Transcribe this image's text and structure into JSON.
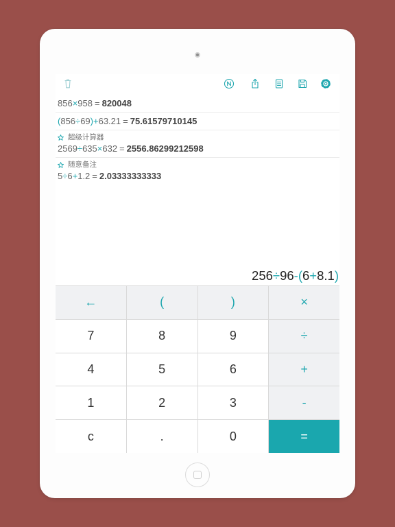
{
  "colors": {
    "backdrop": "#9a4f4a",
    "accent": "#1fa7af",
    "operator_key_background": "#f0f1f3",
    "equals_key_background": "#1aa7ae"
  },
  "toolbar": {
    "icons": [
      "trash-icon",
      "letter-n-circle-icon",
      "share-icon",
      "document-list-icon",
      "save-icon",
      "settings-gear-icon"
    ]
  },
  "history": [
    {
      "expression": "856×958",
      "equals": "=",
      "result": "820048"
    },
    {
      "expression": "(856÷69)+63.21",
      "equals": "=",
      "result": "75.61579710145"
    },
    {
      "note": "超级计算器",
      "expression": "2569÷635×632",
      "equals": "=",
      "result": "2556.86299212598"
    },
    {
      "note": "随意备注",
      "expression": "5÷6+1.2",
      "equals": "=",
      "result": "2.03333333333"
    }
  ],
  "display": {
    "expression": "256÷96-(6+8.1)"
  },
  "keypad": {
    "rows": [
      [
        "←",
        "(",
        ")",
        "×"
      ],
      [
        "7",
        "8",
        "9",
        "÷"
      ],
      [
        "4",
        "5",
        "6",
        "+"
      ],
      [
        "1",
        "2",
        "3",
        "-"
      ],
      [
        "c",
        ".",
        "0",
        "="
      ]
    ]
  }
}
